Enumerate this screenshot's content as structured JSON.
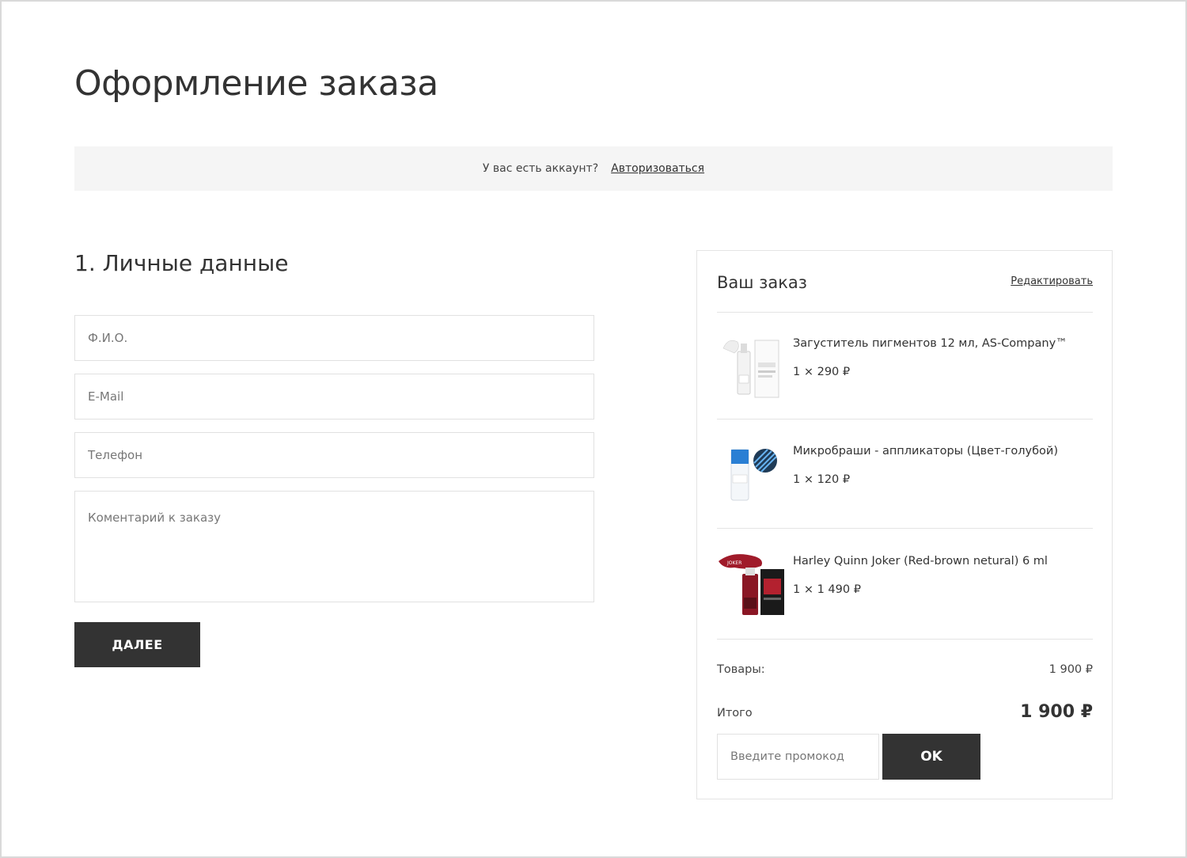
{
  "page": {
    "title": "Оформление заказа"
  },
  "account": {
    "question": "У вас есть аккаунт?",
    "login_link": "Авторизоваться"
  },
  "personal": {
    "section_title": "1. Личные данные",
    "name_placeholder": "Ф.И.О.",
    "email_placeholder": "E-Mail",
    "phone_placeholder": "Телефон",
    "comment_placeholder": "Коментарий к заказу",
    "next_label": "ДАЛЕЕ"
  },
  "order": {
    "title": "Ваш заказ",
    "edit_label": "Редактировать",
    "items": [
      {
        "name": "Загуститель пигментов 12 мл, AS-Company™",
        "qty_price": "1 × 290 ₽"
      },
      {
        "name": "Микробраши - аппликаторы (Цвет-голубой)",
        "qty_price": "1 × 120 ₽"
      },
      {
        "name": "Harley Quinn Joker (Red-brown netural) 6 ml",
        "qty_price": "1 × 1 490 ₽"
      }
    ],
    "goods_label": "Товары:",
    "goods_value": "1 900 ₽",
    "total_label": "Итого",
    "total_value": "1 900 ₽",
    "promo_placeholder": "Введите промокод",
    "ok_label": "OK"
  },
  "thumb_text": {
    "brand": "JOKER"
  },
  "colors": {
    "dark_button": "#333333",
    "bar_bg": "#f5f5f5",
    "border": "#e1e1e1",
    "accent_blue": "#2a7fd4",
    "accent_red": "#a01b2a"
  }
}
